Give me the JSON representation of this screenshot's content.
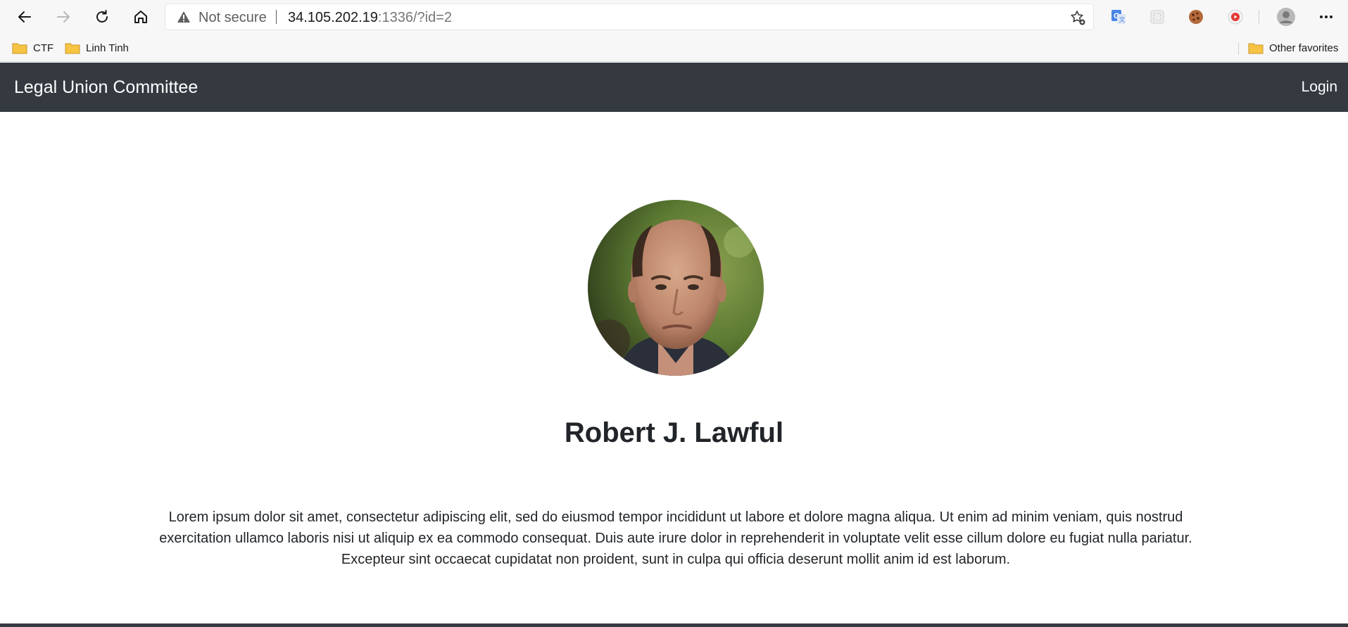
{
  "browser": {
    "address_bar": {
      "security_label": "Not secure",
      "url_host": "34.105.202.19",
      "url_rest": ":1336/?id=2"
    },
    "bookmarks": [
      {
        "label": "CTF",
        "icon": "folder-icon"
      },
      {
        "label": "Linh Tinh",
        "icon": "folder-icon"
      }
    ],
    "other_favorites": "Other favorites"
  },
  "site": {
    "brand": "Legal Union Committee",
    "nav_login": "Login"
  },
  "profile": {
    "name": "Robert J. Lawful",
    "bio": "Lorem ipsum dolor sit amet, consectetur adipiscing elit, sed do eiusmod tempor incididunt ut labore et dolore magna aliqua. Ut enim ad minim veniam, quis nostrud exercitation ullamco laboris nisi ut aliquip ex ea commodo consequat. Duis aute irure dolor in reprehenderit in voluptate velit esse cillum dolore eu fugiat nulla pariatur. Excepteur sint occaecat cupidatat non proident, sunt in culpa qui officia deserunt mollit anim id est laborum."
  },
  "colors": {
    "navbar": "#343a40",
    "text": "#212529",
    "chrome": "#f7f7f7",
    "folder": "#f6c343"
  }
}
